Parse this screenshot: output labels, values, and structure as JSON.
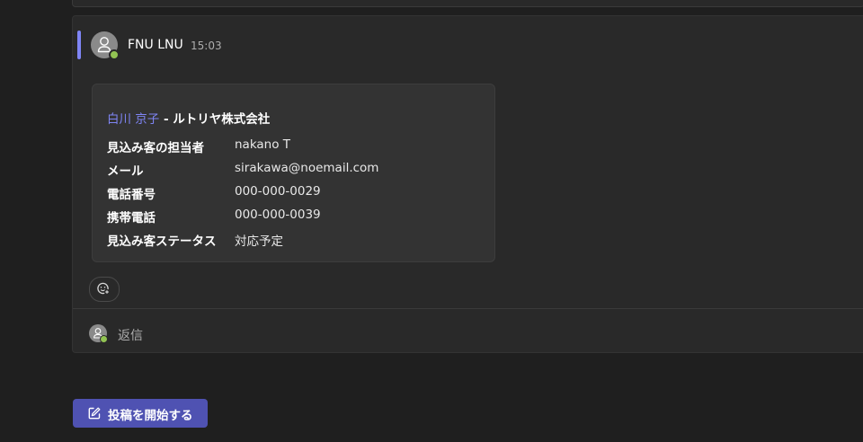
{
  "post": {
    "author": "FNU LNU",
    "time": "15:03",
    "card": {
      "link_name": "白川 京子",
      "company": " - ルトリヤ株式会社",
      "rows": [
        {
          "label": "見込み客の担当者",
          "value": "nakano T"
        },
        {
          "label": "メール",
          "value": "sirakawa@noemail.com"
        },
        {
          "label": "電話番号",
          "value": "000-000-0029"
        },
        {
          "label": "携帯電話",
          "value": "000-000-0039"
        },
        {
          "label": "見込み客ステータス",
          "value": "対応予定"
        }
      ]
    },
    "reply_label": "返信"
  },
  "compose": {
    "new_post_label": "投稿を開始する"
  },
  "colors": {
    "accent": "#7f85f5",
    "button": "#4f52b2",
    "presence": "#92c353"
  },
  "icons": {
    "avatar": "person-icon",
    "presence": "available-check-icon",
    "reaction": "add-reaction-icon",
    "compose": "compose-icon"
  }
}
